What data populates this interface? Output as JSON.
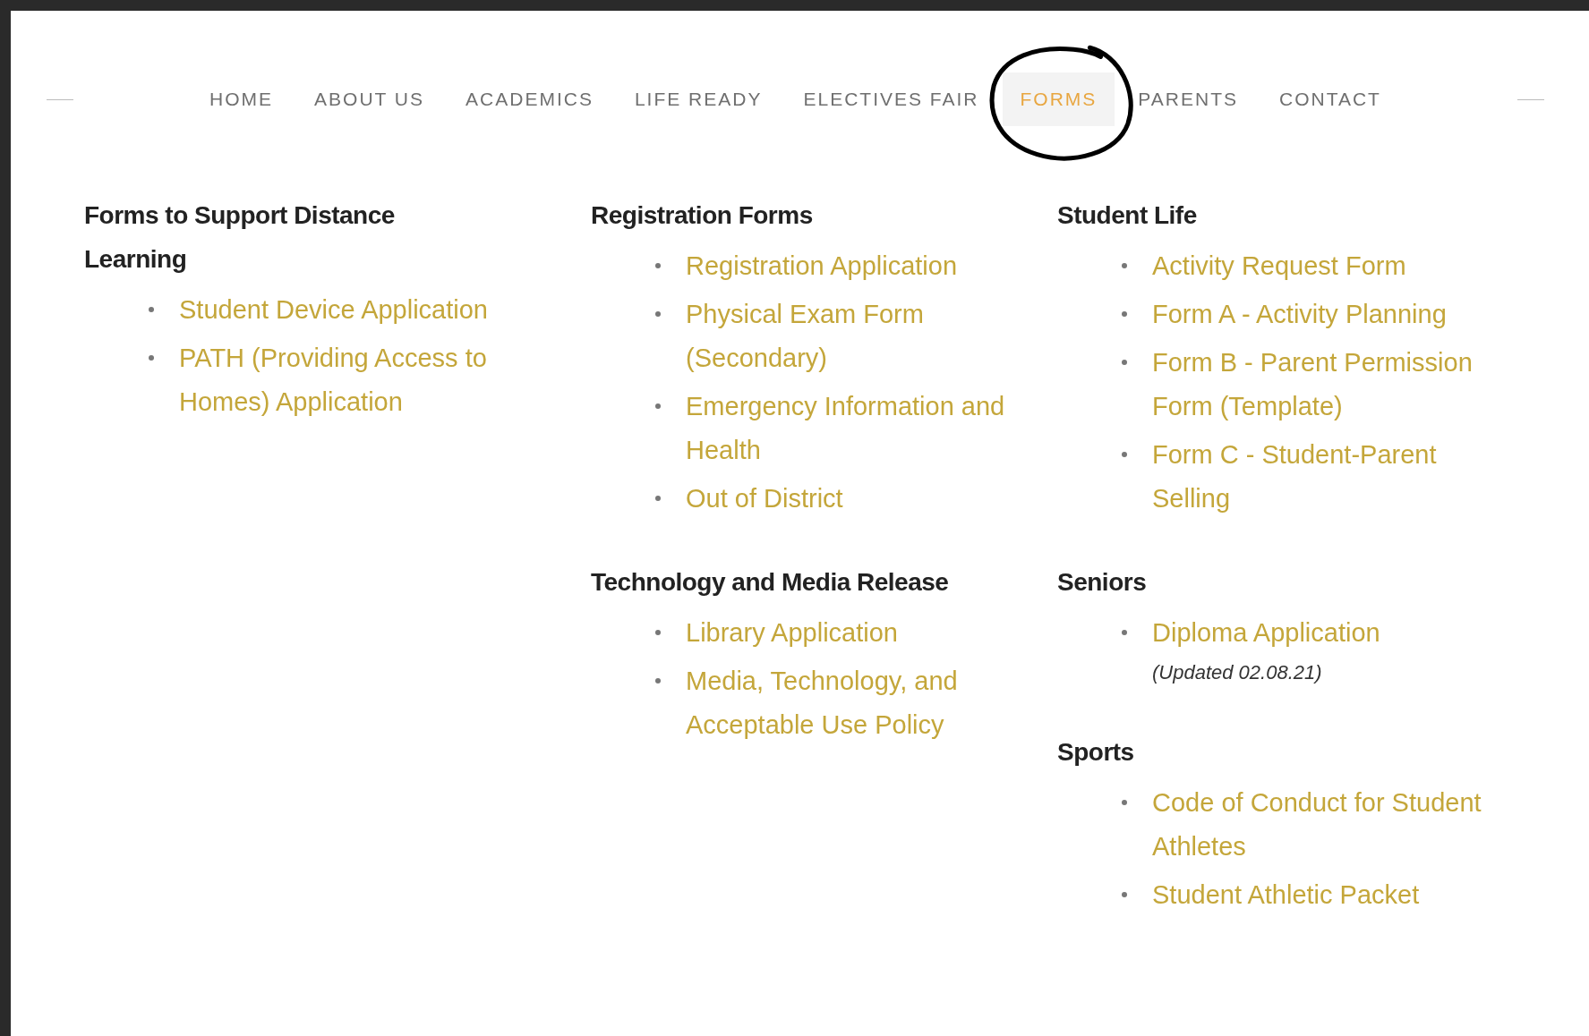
{
  "nav": {
    "items": [
      {
        "label": "HOME",
        "selected": false
      },
      {
        "label": "ABOUT US",
        "selected": false
      },
      {
        "label": "ACADEMICS",
        "selected": false
      },
      {
        "label": "LIFE READY",
        "selected": false
      },
      {
        "label": "ELECTIVES FAIR",
        "selected": false
      },
      {
        "label": "FORMS",
        "selected": true
      },
      {
        "label": "PARENTS",
        "selected": false
      },
      {
        "label": "CONTACT",
        "selected": false
      }
    ]
  },
  "columns": [
    {
      "sections": [
        {
          "title": "Forms to Support Distance Learning",
          "links": [
            {
              "text": "Student Device Application"
            },
            {
              "text": "PATH (Providing  Access to Homes) Application"
            }
          ]
        }
      ]
    },
    {
      "sections": [
        {
          "title": "Registration Forms",
          "links": [
            {
              "text": "Registration Application"
            },
            {
              "text": "Physical Exam Form (Secondary)"
            },
            {
              "text": "Emergency Information and Health"
            },
            {
              "text": "Out of District"
            }
          ]
        },
        {
          "title": "Technology and Media Release",
          "links": [
            {
              "text": "Library Application"
            },
            {
              "text": "Media, Technology, and Acceptable Use Policy"
            }
          ]
        }
      ]
    },
    {
      "sections": [
        {
          "title": "Student Life",
          "links": [
            {
              "text": "Activity Request Form"
            },
            {
              "text": "Form A - Activity Planning"
            },
            {
              "text": "Form B - Parent Permission Form (Template)"
            },
            {
              "text": "Form C - Student-Parent Selling"
            }
          ]
        },
        {
          "title": "Seniors",
          "links": [
            {
              "text": "Diploma Application",
              "note": "(Updated 02.08.21)"
            }
          ]
        },
        {
          "title": "Sports",
          "links": [
            {
              "text": "Code of Conduct for Student Athletes"
            },
            {
              "text": "Student Athletic Packet"
            }
          ]
        }
      ]
    }
  ]
}
